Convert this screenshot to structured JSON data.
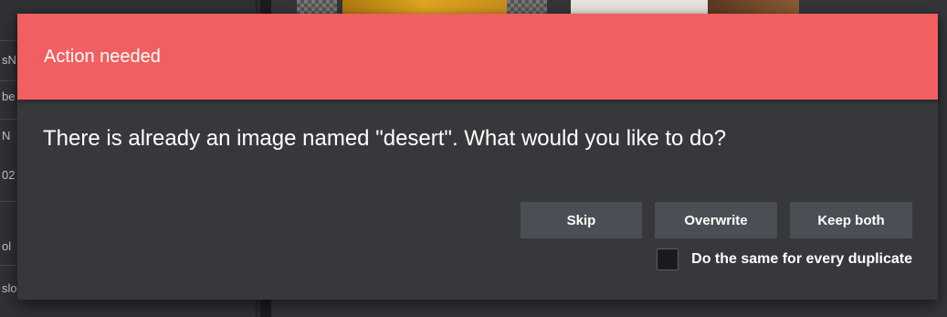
{
  "dialog": {
    "title": "Action needed",
    "message": "There is already an image named \"desert\". What would you like to do?",
    "buttons": {
      "skip": "Skip",
      "overwrite": "Overwrite",
      "keep_both": "Keep both"
    },
    "checkbox": {
      "label": "Do the same for every duplicate",
      "checked": false
    }
  },
  "background": {
    "left_panel_fragments": [
      "sN",
      "be",
      "N",
      "02",
      "ol",
      "slo"
    ]
  },
  "colors": {
    "header": "#f25f60",
    "dialog_bg": "#36383c",
    "button_bg": "#4b4e54",
    "text": "#ffffff"
  }
}
